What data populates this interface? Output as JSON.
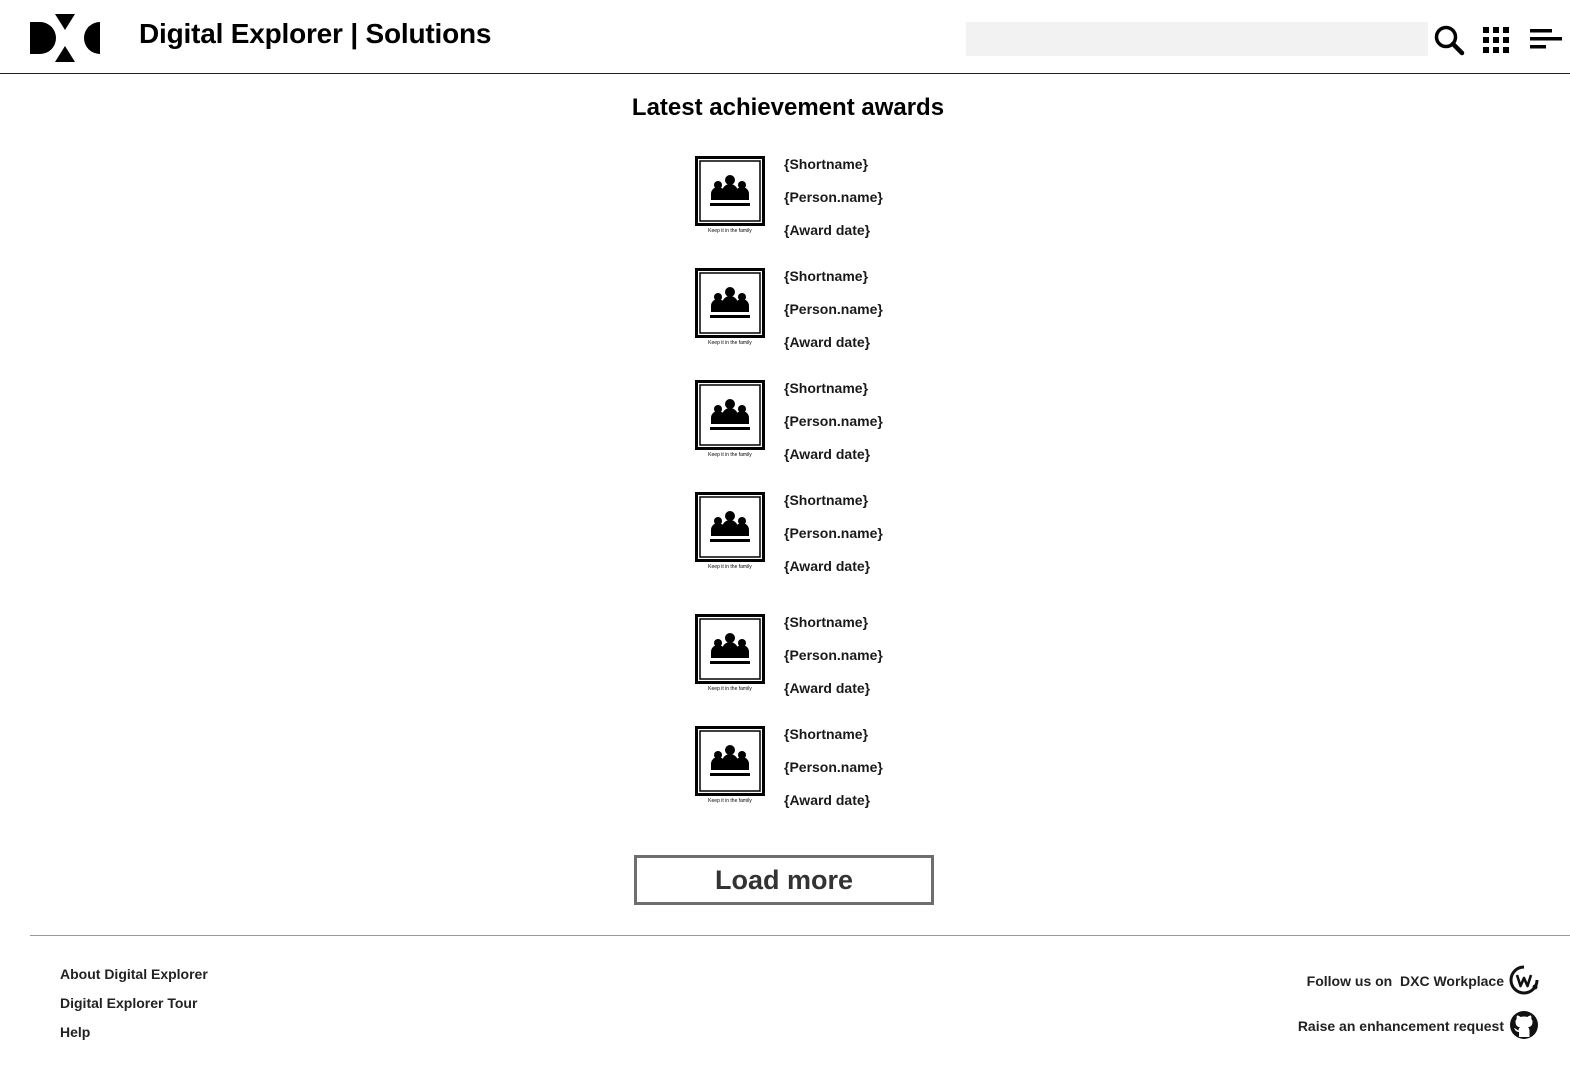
{
  "header": {
    "app_title": "Digital Explorer | Solutions",
    "search_placeholder": "",
    "logo_alt": "DXC"
  },
  "main": {
    "section_title": "Latest achievement awards",
    "awards": [
      {
        "shortname": "{Shortname}",
        "person": "{Person.name}",
        "date": "{Award date}",
        "badge_caption": "Keep it in the family"
      },
      {
        "shortname": "{Shortname}",
        "person": "{Person.name}",
        "date": "{Award date}",
        "badge_caption": "Keep it in the family"
      },
      {
        "shortname": "{Shortname}",
        "person": "{Person.name}",
        "date": "{Award date}",
        "badge_caption": "Keep it in the family"
      },
      {
        "shortname": "{Shortname}",
        "person": "{Person.name}",
        "date": "{Award date}",
        "badge_caption": "Keep it in the family"
      },
      {
        "shortname": "{Shortname}",
        "person": "{Person.name}",
        "date": "{Award date}",
        "badge_caption": "Keep it in the family"
      },
      {
        "shortname": "{Shortname}",
        "person": "{Person.name}",
        "date": "{Award date}",
        "badge_caption": "Keep it in the family"
      }
    ],
    "load_more_label": "Load more"
  },
  "footer": {
    "links": [
      "About Digital Explorer",
      "Digital Explorer Tour",
      "Help"
    ],
    "follow_prefix": "Follow us on",
    "follow_target": "DXC Workplace",
    "enhancement": "Raise an enhancement request"
  },
  "icons": {
    "search": "search-icon",
    "apps": "apps-grid-icon",
    "menu": "menu-icon",
    "badge": "people-group-icon",
    "workplace": "workplace-icon",
    "github": "github-icon"
  }
}
